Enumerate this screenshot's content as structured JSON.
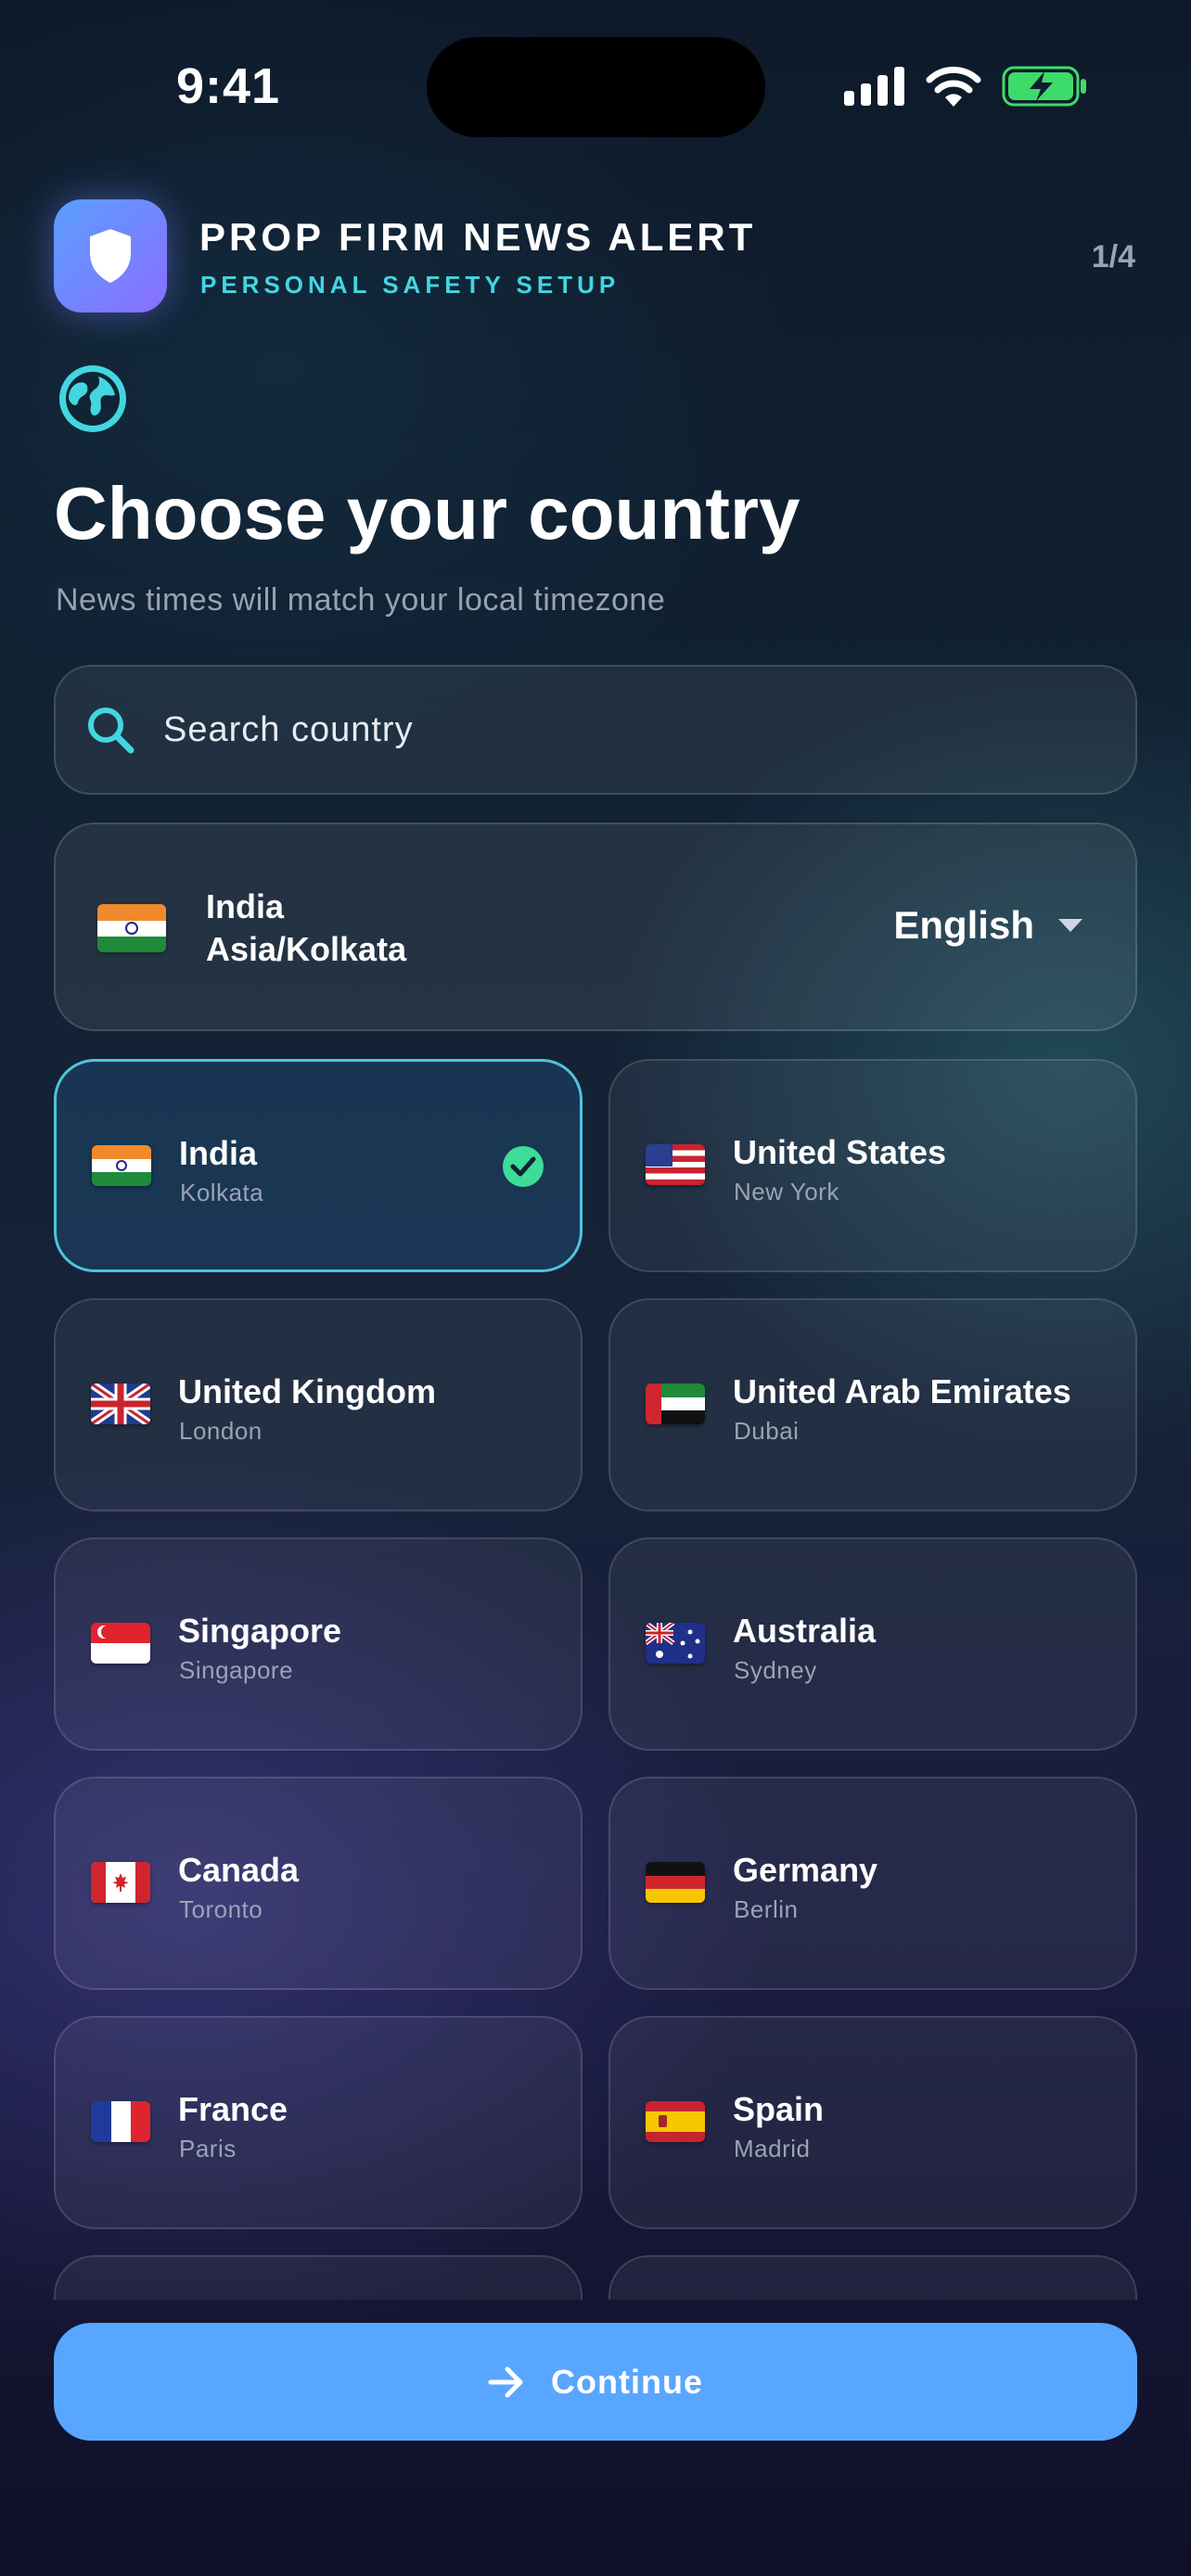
{
  "status_bar": {
    "time": "9:41"
  },
  "header": {
    "app_title": "PROP FIRM NEWS ALERT",
    "app_subtitle": "PERSONAL SAFETY SETUP",
    "step": "1/4"
  },
  "page": {
    "title": "Choose your country",
    "subtitle": "News times will match your local timezone"
  },
  "search": {
    "placeholder": "Search country"
  },
  "selected": {
    "country": "India",
    "timezone": "Asia/Kolkata",
    "language": "English"
  },
  "countries": [
    {
      "name": "India",
      "city": "Kolkata",
      "flag": "india-flag-icon",
      "selected": true
    },
    {
      "name": "United States",
      "city": "New York",
      "flag": "us-flag-icon",
      "selected": false
    },
    {
      "name": "United Kingdom",
      "city": "London",
      "flag": "uk-flag-icon",
      "selected": false
    },
    {
      "name": "United Arab Emirates",
      "city": "Dubai",
      "flag": "uae-flag-icon",
      "selected": false
    },
    {
      "name": "Singapore",
      "city": "Singapore",
      "flag": "singapore-flag-icon",
      "selected": false
    },
    {
      "name": "Australia",
      "city": "Sydney",
      "flag": "australia-flag-icon",
      "selected": false
    },
    {
      "name": "Canada",
      "city": "Toronto",
      "flag": "canada-flag-icon",
      "selected": false
    },
    {
      "name": "Germany",
      "city": "Berlin",
      "flag": "germany-flag-icon",
      "selected": false
    },
    {
      "name": "France",
      "city": "Paris",
      "flag": "france-flag-icon",
      "selected": false
    },
    {
      "name": "Spain",
      "city": "Madrid",
      "flag": "spain-flag-icon",
      "selected": false
    }
  ],
  "continue_label": "Continue",
  "colors": {
    "accent": "#58a6ff",
    "teal": "#43d6e0",
    "check": "#3ddc97"
  }
}
